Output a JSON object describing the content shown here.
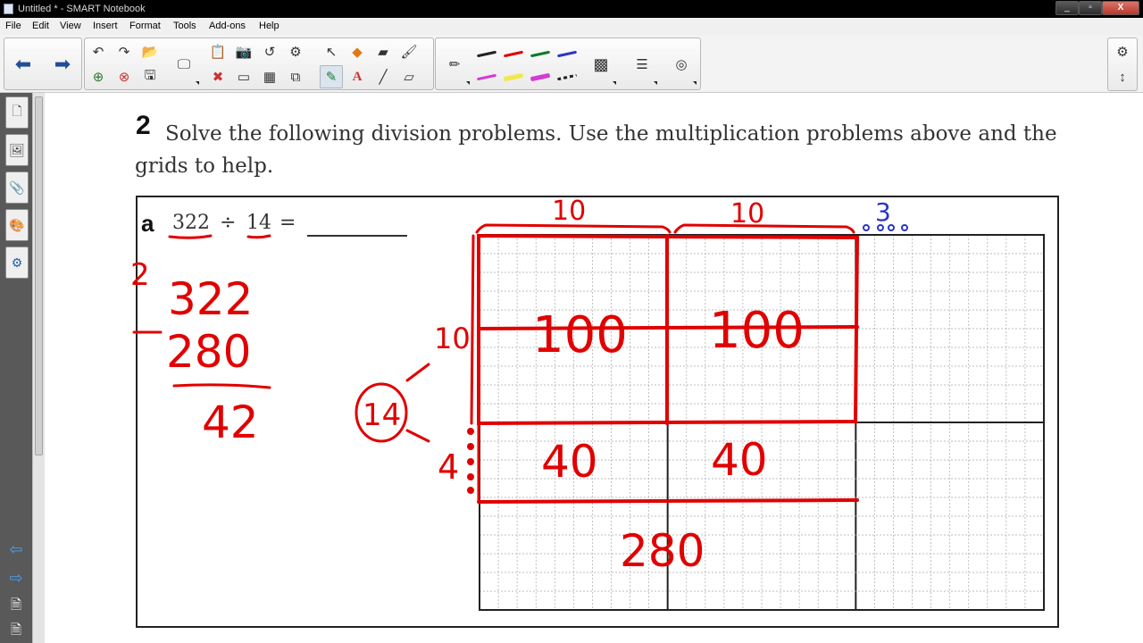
{
  "window": {
    "title": "Untitled * - SMART Notebook",
    "controls": {
      "minimize": "_",
      "maximize": "▫",
      "close": "X"
    }
  },
  "menu": [
    "File",
    "Edit",
    "View",
    "Insert",
    "Format",
    "Tools",
    "Add-ons",
    "Help"
  ],
  "toolbar": {
    "icons": {
      "back": "left-arrow-icon",
      "forward": "right-arrow-icon",
      "undo": "undo-icon",
      "redo": "redo-icon",
      "open": "open-folder-icon",
      "add_page": "add-page-icon",
      "delete_page": "delete-page-icon",
      "save": "save-icon",
      "screen": "screen-display-icon",
      "paste": "paste-icon",
      "screen_capture": "screen-capture-icon",
      "reset": "reset-page-icon",
      "properties": "properties-icon",
      "delete": "delete-icon",
      "screen_shade": "screen-shade-icon",
      "table": "table-icon",
      "full_screen": "full-screen-icon",
      "select": "select-pointer-icon",
      "shapes": "shapes-icon",
      "eraser": "eraser-icon",
      "fill": "fill-icon",
      "pens": "pens-icon",
      "text": "text-tool-icon",
      "lines": "line-tool-icon",
      "erase": "erase-icon",
      "creative_pen": "creative-pen-icon",
      "color_palette": "color-palette-icon",
      "line_style": "line-style-icon",
      "record": "record-icon",
      "settings": "gear-icon",
      "move_toolbar": "move-toolbar-icon"
    },
    "pen_colors": [
      "#222222",
      "#e00000",
      "#0b7a2c",
      "#2a34c8",
      "#d43bd6",
      "#f2e74b",
      "#d43bd6",
      "#222222"
    ],
    "text_tool_letter": "A"
  },
  "sidebar": {
    "tabs": [
      "page-sorter-icon",
      "gallery-icon",
      "attachments-icon",
      "properties-icon",
      "add-ons-icon"
    ],
    "bottom": [
      "prev-page-icon",
      "next-page-icon",
      "add-page-icon",
      "delete-page-icon"
    ]
  },
  "worksheet": {
    "question_number": "2",
    "question_text": "Solve the following division problems. Use the multiplication problems above and the grids to help.",
    "part_label": "a",
    "dividend": "322",
    "division_sign": "÷",
    "divisor": "14",
    "equals": "="
  },
  "annotations": {
    "ink_color": "#e00000",
    "blue_ink_color": "#2a34c8",
    "quotient_digit": "2",
    "long_division": {
      "dividend": "322",
      "minus": "-",
      "subtrahend": "280",
      "remainder": "42"
    },
    "top_labels": [
      "10",
      "10"
    ],
    "top_blue_label": "3",
    "side_labels": [
      "10",
      "4"
    ],
    "divisor_circled": "14",
    "cells": [
      "100",
      "100",
      "40",
      "40"
    ],
    "partial_product": "280"
  }
}
